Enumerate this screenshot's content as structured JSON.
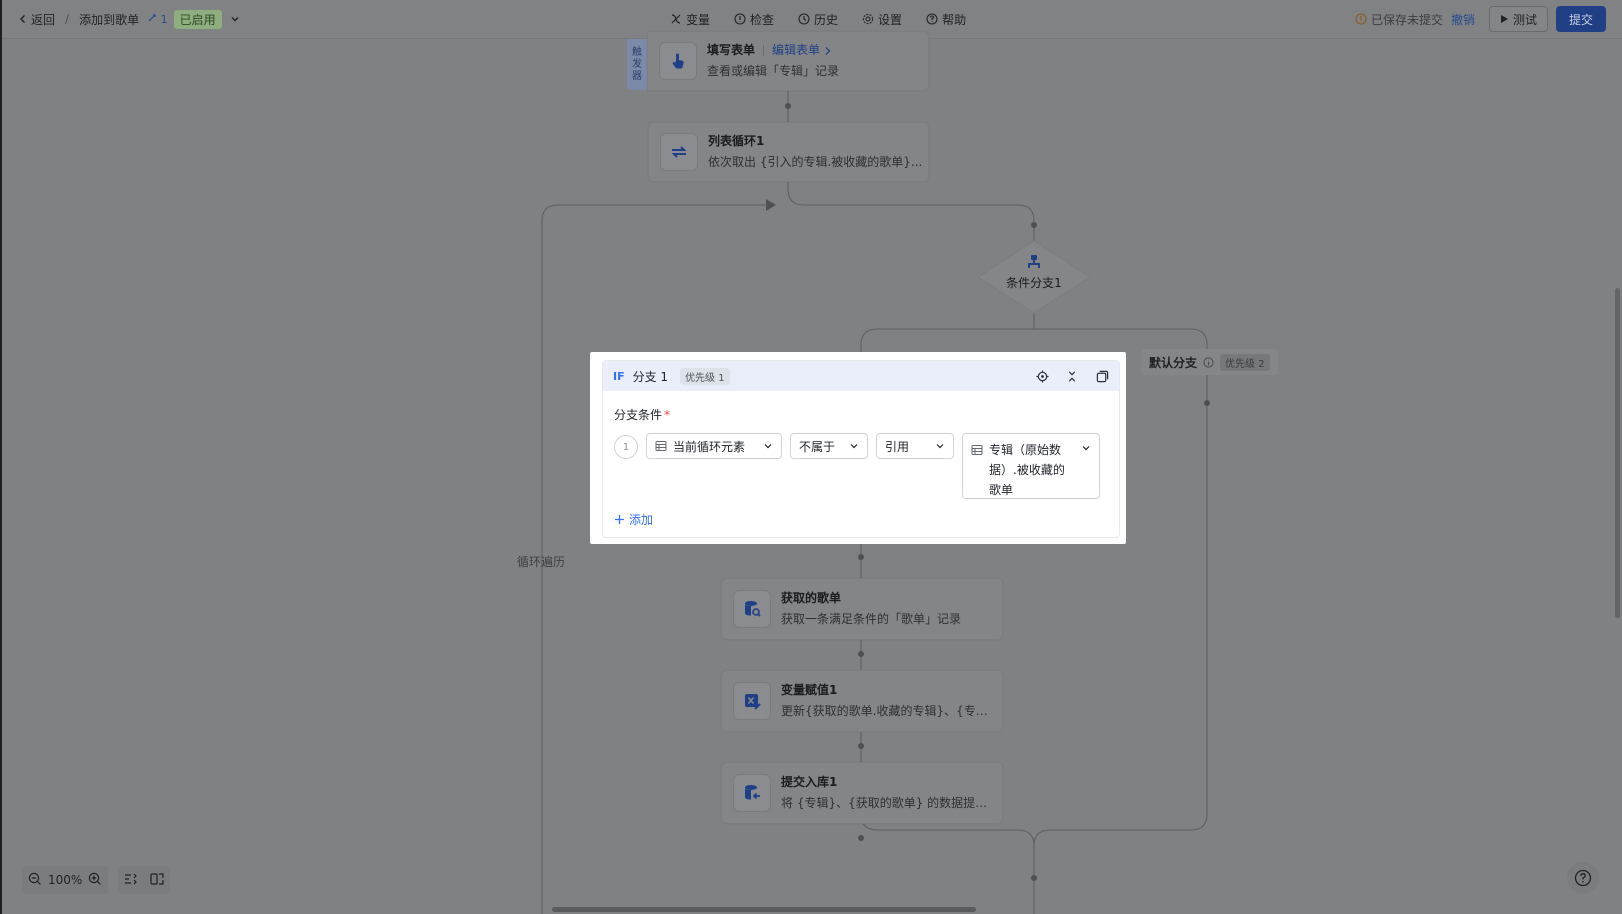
{
  "topbar": {
    "back_label": "返回",
    "app_name": "添加到歌单",
    "version": "1",
    "status": "已启用",
    "menu": {
      "variables": "变量",
      "check": "检查",
      "history": "历史",
      "settings": "设置",
      "help": "帮助"
    },
    "save_status": "已保存未提交",
    "undo": "撤销",
    "test": "测试",
    "submit": "提交"
  },
  "canvas": {
    "trigger_tag": [
      "触",
      "发",
      "器"
    ],
    "nodes": {
      "form": {
        "title": "填写表单",
        "link": "编辑表单",
        "desc": "查看或编辑「专辑」记录"
      },
      "loop": {
        "title": "列表循环1",
        "desc": "依次取出 {引入的专辑.被收藏的歌单}..."
      },
      "condition": {
        "title": "条件分支1"
      },
      "get_playlist": {
        "title": "获取的歌单",
        "desc": "获取一条满足条件的「歌单」记录"
      },
      "assign": {
        "title": "变量赋值1",
        "desc": "更新{获取的歌单.收藏的专辑}、{专辑..."
      },
      "commit": {
        "title": "提交入库1",
        "desc": "将 {专辑}、{获取的歌单} 的数据提交..."
      }
    },
    "loop_label": "循环遍历",
    "default_branch": {
      "label": "默认分支",
      "priority": "优先级 2"
    }
  },
  "dialog": {
    "if_tag": "IF",
    "title": "分支 1",
    "priority": "优先级 1",
    "condition_title": "分支条件",
    "required_mark": "*",
    "condition": {
      "index": "1",
      "field": "当前循环元素",
      "operator": "不属于",
      "value_type": "引用",
      "value_lines": [
        "专辑（原始数",
        "据）.被收藏的",
        "歌单"
      ]
    },
    "add_label": "添加"
  },
  "zoom": {
    "level": "100%"
  }
}
